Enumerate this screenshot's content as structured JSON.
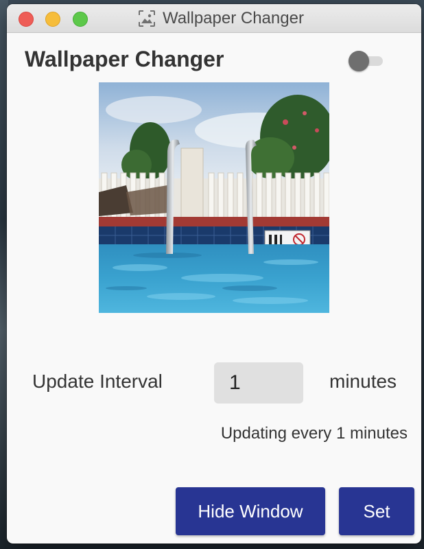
{
  "window": {
    "title": "Wallpaper Changer",
    "title_icon": "image-frame-icon"
  },
  "app": {
    "heading": "Wallpaper Changer",
    "toggle": {
      "state": "off",
      "icon": "toggle-switch"
    }
  },
  "preview": {
    "subject": "swimming pool with ladder wallpaper preview"
  },
  "interval": {
    "label": "Update Interval",
    "value": "1",
    "units": "minutes"
  },
  "status": {
    "text": "Updating every 1 minutes"
  },
  "buttons": {
    "hide": "Hide Window",
    "set": "Set"
  },
  "colors": {
    "button_bg": "#283593",
    "close": "#ee5d57",
    "minimize": "#f6bd3b",
    "maximize": "#5dc84a"
  }
}
